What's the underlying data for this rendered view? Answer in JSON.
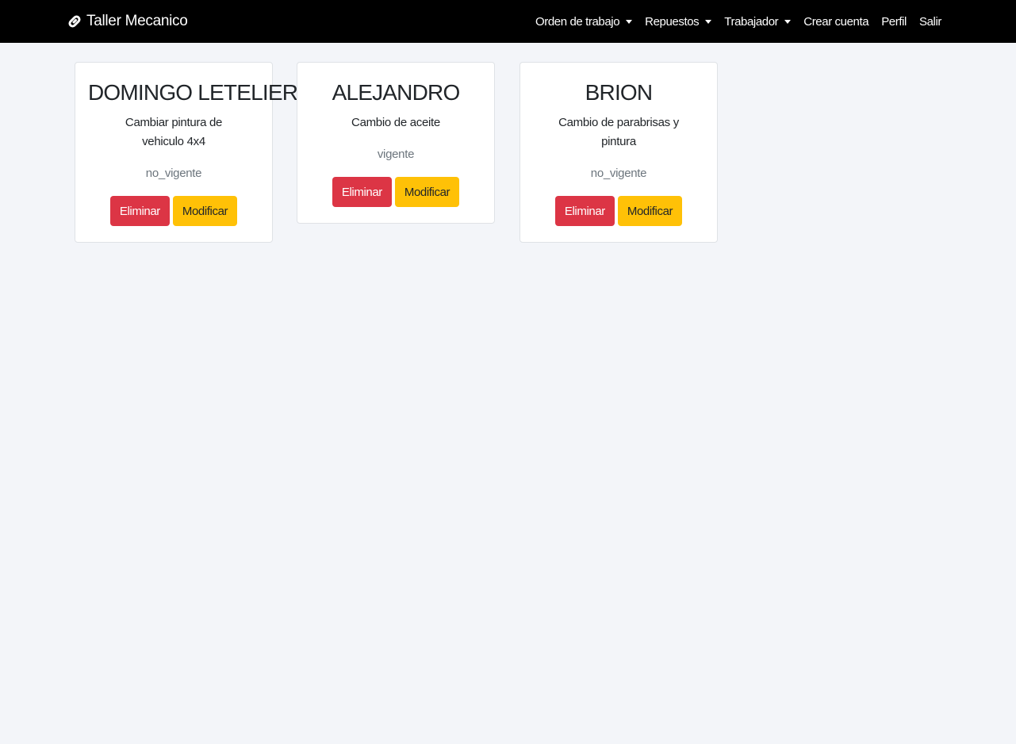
{
  "navbar": {
    "brand": "Taller Mecanico",
    "links": [
      {
        "label": "Orden de trabajo",
        "dropdown": true
      },
      {
        "label": "Repuestos",
        "dropdown": true
      },
      {
        "label": "Trabajador",
        "dropdown": true
      },
      {
        "label": "Crear cuenta",
        "dropdown": false
      },
      {
        "label": "Perfil",
        "dropdown": false
      },
      {
        "label": "Salir",
        "dropdown": false
      }
    ]
  },
  "cards": [
    {
      "name": "DOMINGO LETELIER",
      "description": "Cambiar pintura de vehiculo 4x4",
      "status": "no_vigente",
      "delete_label": "Eliminar",
      "edit_label": "Modificar"
    },
    {
      "name": "ALEJANDRO",
      "description": "Cambio de aceite",
      "status": "vigente",
      "delete_label": "Eliminar",
      "edit_label": "Modificar"
    },
    {
      "name": "BRION",
      "description": "Cambio de parabrisas y pintura",
      "status": "no_vigente",
      "delete_label": "Eliminar",
      "edit_label": "Modificar"
    }
  ],
  "icons": {
    "brand_icon": "link-icon"
  },
  "colors": {
    "navbar_bg": "#000000",
    "page_bg": "#f3f5f9",
    "danger": "#dc3545",
    "warning": "#ffc107",
    "muted": "#6c757d"
  }
}
